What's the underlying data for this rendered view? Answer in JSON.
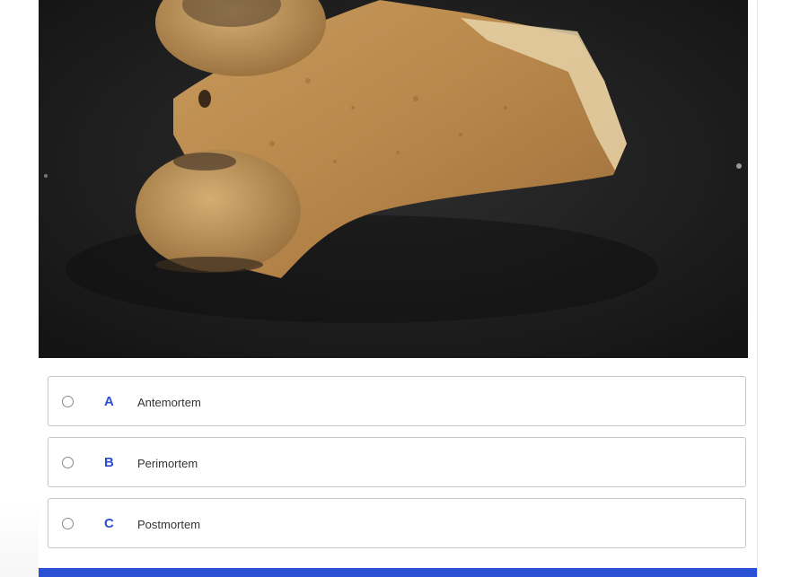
{
  "question_image": {
    "alt": "bone specimen",
    "icon": "bone-photo"
  },
  "options": [
    {
      "letter": "A",
      "label": "Antemortem"
    },
    {
      "letter": "B",
      "label": "Perimortem"
    },
    {
      "letter": "C",
      "label": "Postmortem"
    }
  ],
  "colors": {
    "accent": "#2c4ecb",
    "bar": "#2a50d6",
    "photo_background": "#1f1f1f"
  }
}
